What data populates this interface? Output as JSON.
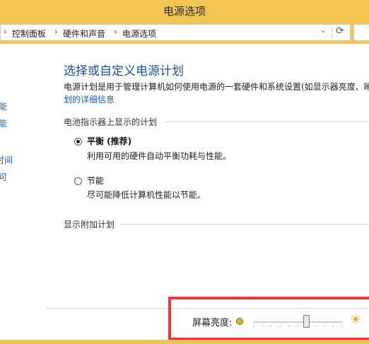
{
  "window": {
    "title": "电源选项"
  },
  "address": {
    "crumbs": [
      "控制面板",
      "硬件和声音",
      "电源选项"
    ],
    "separator": "›",
    "dropdown_glyph": "⌄",
    "refresh_glyph": "⟳"
  },
  "sidebar": {
    "fragments": [
      "能",
      "能",
      "时间",
      "可"
    ]
  },
  "main": {
    "heading": "选择或自定义电源计划",
    "description": "电源计划是用于管理计算机如何使用电源的一套硬件和系统设置(如显示器亮度、睡",
    "description_link": "划的详细信息",
    "battery_section": "电池指示器上显示的计划",
    "plans": [
      {
        "name": "平衡 (推荐)",
        "desc": "利用可用的硬件自动平衡功耗与性能。",
        "selected": true
      },
      {
        "name": "节能",
        "desc": "尽可能降低计算机性能以节能。",
        "selected": false
      }
    ],
    "more_plans": "显示附加计划"
  },
  "brightness": {
    "label": "屏幕亮度:",
    "level_fraction": 0.6,
    "low_icon": "dim-sun-icon",
    "high_icon": "bright-sun-icon",
    "high_glyph": "☀",
    "highlight_color": "#e8343a"
  },
  "colors": {
    "titlebar": "#f0c552",
    "heading": "#1d4f91",
    "link": "#1c5aa8"
  }
}
